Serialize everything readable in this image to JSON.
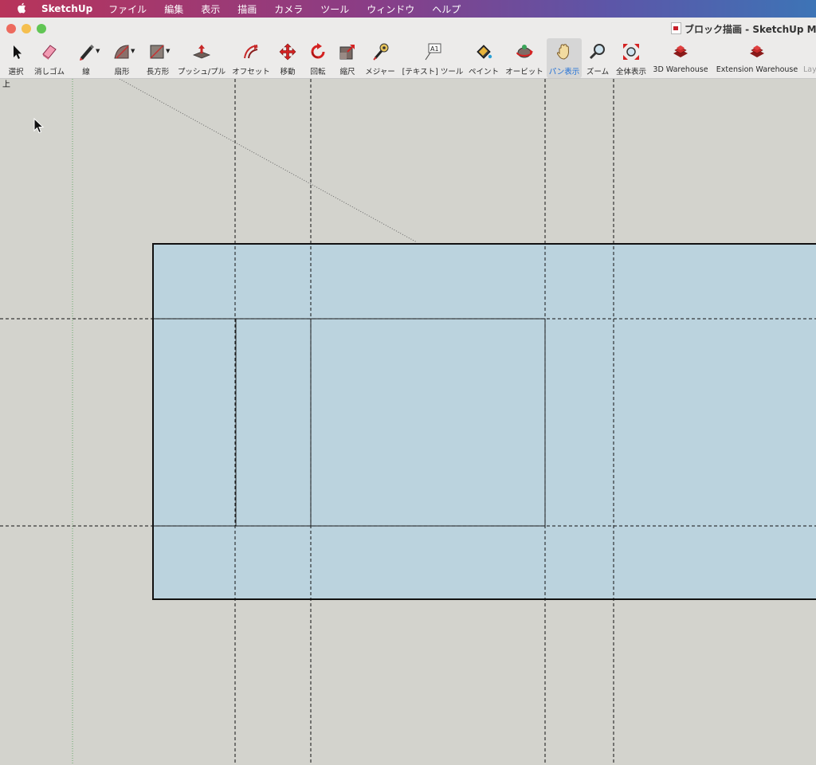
{
  "menubar": {
    "apple": "",
    "app_name": "SketchUp",
    "items": [
      "ファイル",
      "編集",
      "表示",
      "描画",
      "カメラ",
      "ツール",
      "ウィンドウ",
      "ヘルプ"
    ]
  },
  "window": {
    "title": "ブロック描画 - SketchUp Mak"
  },
  "toolbar": {
    "tools": [
      {
        "id": "select",
        "label": "選択",
        "icon": "select-arrow-icon"
      },
      {
        "id": "eraser",
        "label": "消しゴム",
        "icon": "eraser-icon"
      },
      {
        "id": "line",
        "label": "線",
        "icon": "pencil-icon"
      },
      {
        "id": "arc",
        "label": "扇形",
        "icon": "arc-icon"
      },
      {
        "id": "rectangle",
        "label": "長方形",
        "icon": "rectangle-icon"
      },
      {
        "id": "pushpull",
        "label": "プッシュ/プル",
        "icon": "push-pull-icon"
      },
      {
        "id": "offset",
        "label": "オフセット",
        "icon": "offset-icon"
      },
      {
        "id": "move",
        "label": "移動",
        "icon": "move-icon"
      },
      {
        "id": "rotate",
        "label": "回転",
        "icon": "rotate-icon"
      },
      {
        "id": "scale",
        "label": "縮尺",
        "icon": "scale-icon"
      },
      {
        "id": "tape",
        "label": "メジャー",
        "icon": "tape-measure-icon"
      },
      {
        "id": "text",
        "label": "[テキスト] ツール",
        "icon": "text-tool-icon"
      },
      {
        "id": "paint",
        "label": "ペイント",
        "icon": "paint-bucket-icon"
      },
      {
        "id": "orbit",
        "label": "オービット",
        "icon": "orbit-icon"
      },
      {
        "id": "pan",
        "label": "パン表示",
        "icon": "pan-hand-icon"
      },
      {
        "id": "zoom",
        "label": "ズーム",
        "icon": "zoom-icon"
      },
      {
        "id": "zoomext",
        "label": "全体表示",
        "icon": "zoom-extents-icon"
      },
      {
        "id": "warehouse",
        "label": "3D Warehouse",
        "icon": "warehouse-icon"
      },
      {
        "id": "extwarehouse",
        "label": "Extension Warehouse",
        "icon": "extension-warehouse-icon"
      },
      {
        "id": "layout",
        "label": "Lay",
        "icon": "layout-icon"
      }
    ],
    "active_tool": "pan"
  },
  "canvas": {
    "view_label": "上",
    "face_color": "#bbd3de",
    "background_color": "#d3d3cd"
  }
}
